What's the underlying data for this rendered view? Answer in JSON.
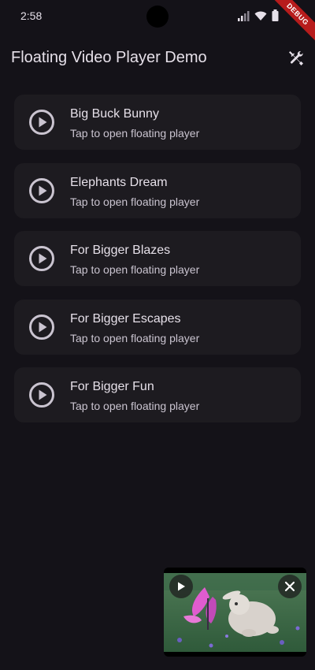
{
  "status_bar": {
    "time": "2:58",
    "icons": [
      "signal-icon",
      "wifi-icon",
      "battery-icon"
    ],
    "debug_label": "DEBUG"
  },
  "app_bar": {
    "title": "Floating Video Player Demo",
    "action_icon": "tools-icon"
  },
  "videos": [
    {
      "title": "Big Buck Bunny",
      "subtitle": "Tap to open floating player"
    },
    {
      "title": "Elephants Dream",
      "subtitle": "Tap to open floating player"
    },
    {
      "title": "For Bigger Blazes",
      "subtitle": "Tap to open floating player"
    },
    {
      "title": "For Bigger Escapes",
      "subtitle": "Tap to open floating player"
    },
    {
      "title": "For Bigger Fun",
      "subtitle": "Tap to open floating player"
    }
  ],
  "floating_player": {
    "play_icon": "play-icon",
    "close_icon": "close-icon"
  },
  "colors": {
    "background": "#141218",
    "card": "#1D1B20",
    "text_primary": "#E6E0E9",
    "text_secondary": "#CAC4D0",
    "debug_banner": "#B71C1C"
  }
}
